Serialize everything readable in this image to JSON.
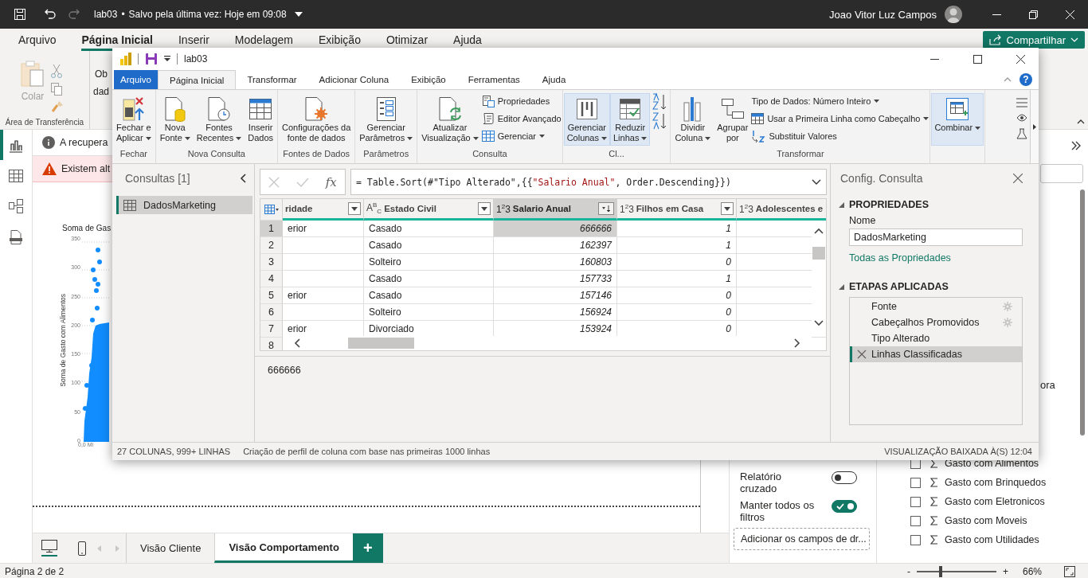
{
  "title_bar": {
    "file": "lab03",
    "separator": "•",
    "save_status": "Salvo pela última vez: Hoje em 09:08",
    "user": "Joao Vitor Luz Campos"
  },
  "ribbon_tabs": [
    {
      "label": "Arquivo",
      "selected": false
    },
    {
      "label": "Página Inicial",
      "selected": true
    },
    {
      "label": "Inserir",
      "selected": false
    },
    {
      "label": "Modelagem",
      "selected": false
    },
    {
      "label": "Exibição",
      "selected": false
    },
    {
      "label": "Otimizar",
      "selected": false
    },
    {
      "label": "Ajuda",
      "selected": false
    }
  ],
  "share_button": "Compartilhar",
  "ribbon": {
    "paste": {
      "label": "Colar",
      "disabled": true
    },
    "clipboard_label": "Área de Transferência",
    "get_data_lines": [
      "Ob",
      "dad"
    ]
  },
  "banners": [
    {
      "kind": "info",
      "text": "A recupera"
    },
    {
      "kind": "warning",
      "text": "Existem alt"
    }
  ],
  "visual": {
    "title": "Soma de Gas",
    "y_label": "Soma de Gasto com Alimentos",
    "y_ticks": [
      "350",
      "300",
      "250",
      "200",
      "150",
      "100",
      "50",
      "0"
    ],
    "x_tick": "0,0 Mi"
  },
  "page_tabs": [
    {
      "label": "Visão Cliente",
      "selected": false
    },
    {
      "label": "Visão Comportamento",
      "selected": true
    }
  ],
  "add_page": "+",
  "filters": {
    "toggles": [
      {
        "label": "Relatório cruzado",
        "on": false
      },
      {
        "label": "Manter todos os filtros",
        "on": true
      }
    ],
    "drop_hint": "Adicionar os campos de dr..."
  },
  "fields": {
    "partial_label": "ora",
    "items": [
      {
        "label": "Gasto com Alimentos",
        "checked": false
      },
      {
        "label": "Gasto com Brinquedos",
        "checked": false
      },
      {
        "label": "Gasto com Eletronicos",
        "checked": false
      },
      {
        "label": "Gasto com Moveis",
        "checked": false
      },
      {
        "label": "Gasto com Utilidades",
        "checked": false
      }
    ]
  },
  "status_bar": {
    "page": "Página 2 de 2",
    "zoom_out": "-",
    "zoom_in": "+",
    "zoom": {
      "level": 0.3,
      "reading": "66%"
    }
  },
  "power_query": {
    "title": "lab03",
    "help": "?",
    "tabs": [
      {
        "label": "Arquivo",
        "kind": "file",
        "selected": false
      },
      {
        "label": "Página Inicial",
        "kind": "tab",
        "selected": true
      },
      {
        "label": "Transformar",
        "kind": "tab",
        "selected": false
      },
      {
        "label": "Adicionar Coluna",
        "kind": "tab",
        "selected": false
      },
      {
        "label": "Exibição",
        "kind": "tab",
        "selected": false
      },
      {
        "label": "Ferramentas",
        "kind": "tab",
        "selected": false
      },
      {
        "label": "Ajuda",
        "kind": "tab",
        "selected": false
      }
    ],
    "ribbon_groups": [
      {
        "label": "Fechar",
        "buttons": [
          {
            "kind": "large",
            "lines": [
              "Fechar e",
              "Aplicar"
            ],
            "dropdown": true,
            "highlighted": false
          }
        ]
      },
      {
        "label": "Nova Consulta",
        "buttons": [
          {
            "kind": "large",
            "lines": [
              "Nova",
              "Fonte"
            ],
            "dropdown": true,
            "highlighted": false
          },
          {
            "kind": "large",
            "lines": [
              "Fontes",
              "Recentes"
            ],
            "dropdown": true,
            "highlighted": false
          },
          {
            "kind": "large",
            "lines": [
              "Inserir",
              "Dados"
            ],
            "dropdown": false,
            "highlighted": false
          }
        ]
      },
      {
        "label": "Fontes de Dados",
        "buttons": [
          {
            "kind": "large",
            "lines": [
              "Configurações da",
              "fonte de dados"
            ],
            "dropdown": false,
            "highlighted": false
          }
        ]
      },
      {
        "label": "Parâmetros",
        "buttons": [
          {
            "kind": "large",
            "lines": [
              "Gerenciar",
              "Parâmetros"
            ],
            "dropdown": true,
            "highlighted": false
          }
        ]
      },
      {
        "label": "Consulta",
        "buttons": [
          {
            "kind": "large",
            "lines": [
              "Atualizar",
              "Visualização"
            ],
            "dropdown": true,
            "highlighted": false
          },
          {
            "kind": "stack",
            "items": [
              {
                "label": "Propriedades",
                "dropdown": false
              },
              {
                "label": "Editor Avançado",
                "dropdown": false
              },
              {
                "label": "Gerenciar",
                "dropdown": true
              }
            ]
          }
        ]
      },
      {
        "label": "Cl...",
        "buttons": [
          {
            "kind": "large",
            "lines": [
              "Gerenciar",
              "Colunas"
            ],
            "dropdown": true,
            "highlighted": true
          },
          {
            "kind": "large",
            "lines": [
              "Reduzir",
              "Linhas"
            ],
            "dropdown": true,
            "highlighted": true
          },
          {
            "kind": "sort"
          }
        ]
      },
      {
        "label": "Transformar",
        "buttons": [
          {
            "kind": "large",
            "lines": [
              "Dividir",
              "Coluna"
            ],
            "dropdown": true,
            "highlighted": false
          },
          {
            "kind": "large",
            "lines": [
              "Agrupar",
              "por"
            ],
            "dropdown": false,
            "highlighted": false
          },
          {
            "kind": "stack",
            "items": [
              {
                "label": "Tipo de Dados: Número Inteiro",
                "dropdown": true
              },
              {
                "label": "Usar a Primeira Linha como Cabeçalho",
                "dropdown": true
              },
              {
                "label": "Substituir Valores",
                "dropdown": false
              }
            ]
          }
        ]
      },
      {
        "buttons": [
          {
            "kind": "large",
            "lines": [
              "Combinar"
            ],
            "dropdown": true,
            "highlighted": true
          }
        ]
      }
    ],
    "queries": {
      "title": "Consultas [1]",
      "items": [
        {
          "label": "DadosMarketing",
          "selected": true
        }
      ]
    },
    "formula_bar": {
      "function_label": "fx",
      "segments": [
        {
          "kind": "code",
          "text": "= Table.Sort(#\"Tipo Alterado\",{{"
        },
        {
          "kind": "string",
          "text": "\"Salario Anual\""
        },
        {
          "kind": "code",
          "text": ", Order.Descending}})"
        }
      ]
    },
    "grid": {
      "columns": [
        {
          "label": "ridade",
          "selected": false,
          "sorted": false
        },
        {
          "label": "Estado Civil",
          "type": "A$^{B}$$_{C}$",
          "selected": false,
          "sorted": false
        },
        {
          "label": "Salario Anual",
          "type": "1$^{2}$3",
          "selected": true,
          "sorted": true
        },
        {
          "label": "Filhos em Casa",
          "type": "1$^{2}$3",
          "selected": false,
          "sorted": false
        },
        {
          "label": "Adolescentes e",
          "type": "1$^{2}$3",
          "selected": false
        }
      ],
      "rows": [
        {
          "number": "1",
          "selected": true,
          "cells": [
            "erior",
            "Casado",
            "666666",
            "1"
          ]
        },
        {
          "number": "2",
          "selected": false,
          "cells": [
            null,
            "Casado",
            "162397",
            "1"
          ]
        },
        {
          "number": "3",
          "selected": false,
          "cells": [
            null,
            "Solteiro",
            "160803",
            "0"
          ]
        },
        {
          "number": "4",
          "selected": false,
          "cells": [
            null,
            "Casado",
            "157733",
            "1"
          ]
        },
        {
          "number": "5",
          "selected": false,
          "cells": [
            "erior",
            "Casado",
            "157146",
            "0"
          ]
        },
        {
          "number": "6",
          "selected": false,
          "cells": [
            null,
            "Solteiro",
            "156924",
            "0"
          ]
        },
        {
          "number": "7",
          "selected": false,
          "cells": [
            "erior",
            "Divorciado",
            "153924",
            "0"
          ]
        },
        {
          "number": "8",
          "selected": false,
          "cells": []
        }
      ]
    },
    "preview_value": "666666",
    "settings": {
      "title": "Config. Consulta",
      "properties_heading": "PROPRIEDADES",
      "name_label": "Nome",
      "name_value": "DadosMarketing",
      "all_properties_link": "Todas as Propriedades",
      "steps_heading": "ETAPAS APLICADAS",
      "steps": [
        {
          "label": "Fonte",
          "has_settings": true,
          "selected": false
        },
        {
          "label": "Cabeçalhos Promovidos",
          "has_settings": true,
          "selected": false
        },
        {
          "label": "Tipo Alterado",
          "has_settings": false,
          "selected": false
        },
        {
          "label": "Linhas Classificadas",
          "has_settings": false,
          "selected": true
        }
      ]
    },
    "status": {
      "counts": "27 COLUNAS, 999+ LINHAS",
      "profiling": "Criação de perfil de coluna com base nas primeiras 1000 linhas",
      "preview_time": "VISUALIZAÇÃO BAIXADA À(S) 12:04"
    }
  }
}
